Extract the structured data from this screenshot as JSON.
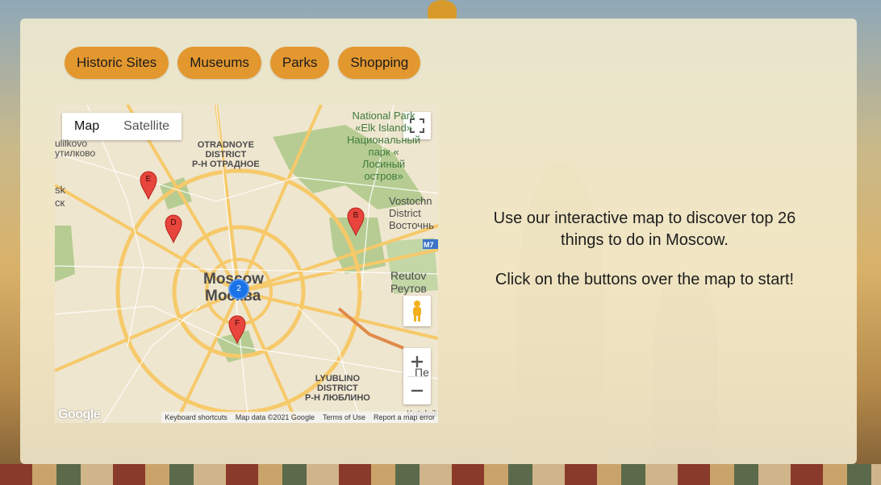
{
  "filters": [
    "Historic Sites",
    "Museums",
    "Parks",
    "Shopping"
  ],
  "map": {
    "type_map": "Map",
    "type_satellite": "Satellite",
    "labels": {
      "otradnoye": "OTRADNOYE\nDISTRICT\nР-Н ОТРАДНОЕ",
      "national_park": "National Park\n«Elk Island»\nНациональный\nпарк «\nЛосиный\nостров»",
      "vostochny": "Vostochn\nDistrict\nВосточнь",
      "reutov": "Reutov\nРеутов",
      "moscow_en": "Moscow",
      "moscow_ru": "Москва",
      "lyublino": "LYUBLINO\nDISTRICT\nР-Н ЛЮБЛИНО",
      "putilkovo": "ulilkovo\nутилково",
      "left_edge": "sk\nск",
      "highway": "M7",
      "kotelniki": "Kotelniki",
      "pe": "Пе"
    },
    "markers": [
      "E",
      "D",
      "B",
      "F"
    ],
    "cluster": "2",
    "footer": {
      "shortcuts": "Keyboard shortcuts",
      "data": "Map data ©2021 Google",
      "terms": "Terms of Use",
      "report": "Report a map error"
    },
    "logo": "Google"
  },
  "intro": {
    "line1": "Use our interactive map to discover top 26 things to do in Moscow.",
    "line2": "Click on the buttons over the map to start!"
  },
  "colors": {
    "button": "#e3972f",
    "road": "#f6c96a",
    "park": "#b6cc92",
    "marker": "#e8453c",
    "cluster": "#1a73e8"
  }
}
